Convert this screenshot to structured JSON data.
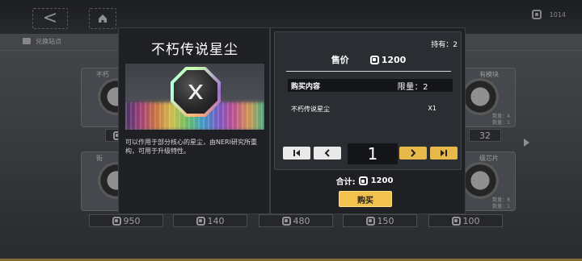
{
  "top": {
    "back_glyph": "<",
    "currency_amount": "1014",
    "station_tab_label": "兑换站点"
  },
  "background_cards": {
    "top_row_labels": [
      "不朽",
      "街",
      "有模块",
      "级芯片"
    ],
    "right_stats": [
      "数量：4",
      "数量：1",
      "数量：8",
      "数量：1"
    ],
    "side_values": [
      "32"
    ],
    "prices": [
      "950",
      "140",
      "480",
      "150",
      "100"
    ]
  },
  "item": {
    "name": "不朽传说星尘",
    "description": "可以作用于部分核心的星尘，由NERI研究所重构，可用于升级特性。"
  },
  "purchase": {
    "owned_label": "持有：2",
    "price_label": "售价",
    "price": "1200",
    "contents_header": "购买内容",
    "limit_label": "限量：2",
    "row_item_name": "不朽传说星尘",
    "row_item_qty": "X1",
    "quantity": "1",
    "total_label": "合计:",
    "total": "1200",
    "buy_label": "购买"
  },
  "colors": {
    "accent_gold": "#f2c14e",
    "panel_dark": "#1e2024"
  }
}
